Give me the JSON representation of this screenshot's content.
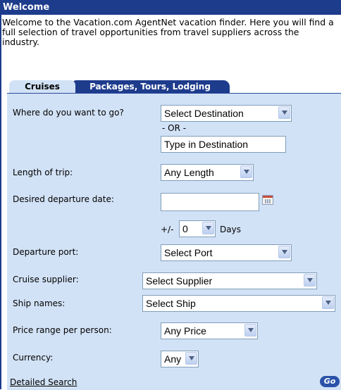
{
  "header": {
    "title": "Welcome"
  },
  "intro": {
    "text": "Welcome to the Vacation.com AgentNet vacation finder. Here you will find a full selection of travel opportunities from travel suppliers across the industry."
  },
  "tabs": [
    {
      "label": "Cruises",
      "active": true
    },
    {
      "label": "Packages, Tours, Lodging",
      "active": false
    }
  ],
  "form": {
    "destination": {
      "label": "Where do you want to go?",
      "select_value": "Select Destination",
      "or_text": "- OR -",
      "text_value": "Type in Destination"
    },
    "length": {
      "label": "Length of trip:",
      "value": "Any Length"
    },
    "departure_date": {
      "label": "Desired departure date:",
      "value": "",
      "plusminus": "+/-",
      "days_value": "0",
      "days_label": "Days"
    },
    "port": {
      "label": "Departure port:",
      "value": "Select Port"
    },
    "supplier": {
      "label": "Cruise supplier:",
      "value": "Select Supplier"
    },
    "ship": {
      "label": "Ship names:",
      "value": "Select Ship"
    },
    "price": {
      "label": "Price range per person:",
      "value": "Any Price"
    },
    "currency": {
      "label": "Currency:",
      "value": "Any"
    }
  },
  "footer": {
    "detailed_search": "Detailed Search",
    "go": "Go"
  },
  "colors": {
    "header_bg": "#1e3c8c",
    "panel_bg": "#d2e2f6",
    "tab_inactive_bg": "#1e3c8c"
  }
}
